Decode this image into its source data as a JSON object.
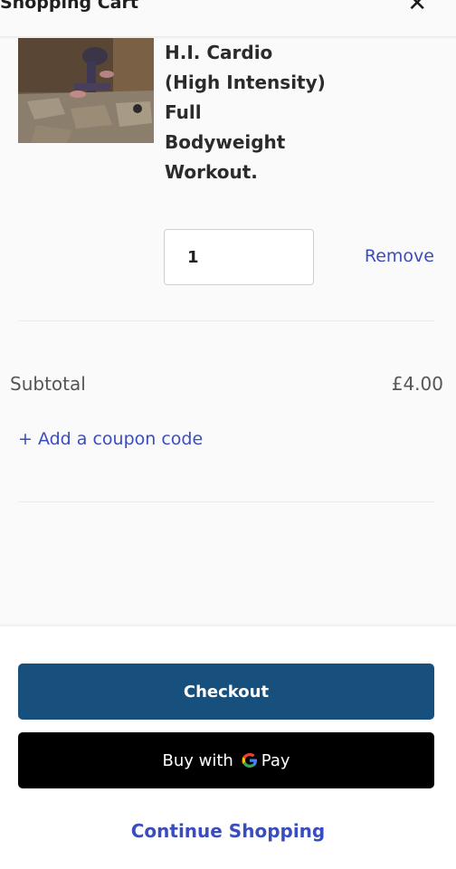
{
  "header": {
    "title": "Shopping Cart",
    "close_icon": "close-icon"
  },
  "item": {
    "name": "H.I. Cardio (High Intensity) Full Bodyweight Workout.",
    "quantity": "1",
    "remove_label": "Remove",
    "thumbnail_icon": "product-thumbnail"
  },
  "summary": {
    "subtotal_label": "Subtotal",
    "subtotal_value": "£4.00",
    "coupon_label": "+ Add a coupon code"
  },
  "actions": {
    "checkout_label": "Checkout",
    "gpay_prefix": "Buy with",
    "gpay_suffix": "Pay",
    "continue_label": "Continue Shopping"
  },
  "colors": {
    "checkout_bg": "#174f7d",
    "link": "#3a4dbf",
    "gpay_bg": "#000000"
  }
}
